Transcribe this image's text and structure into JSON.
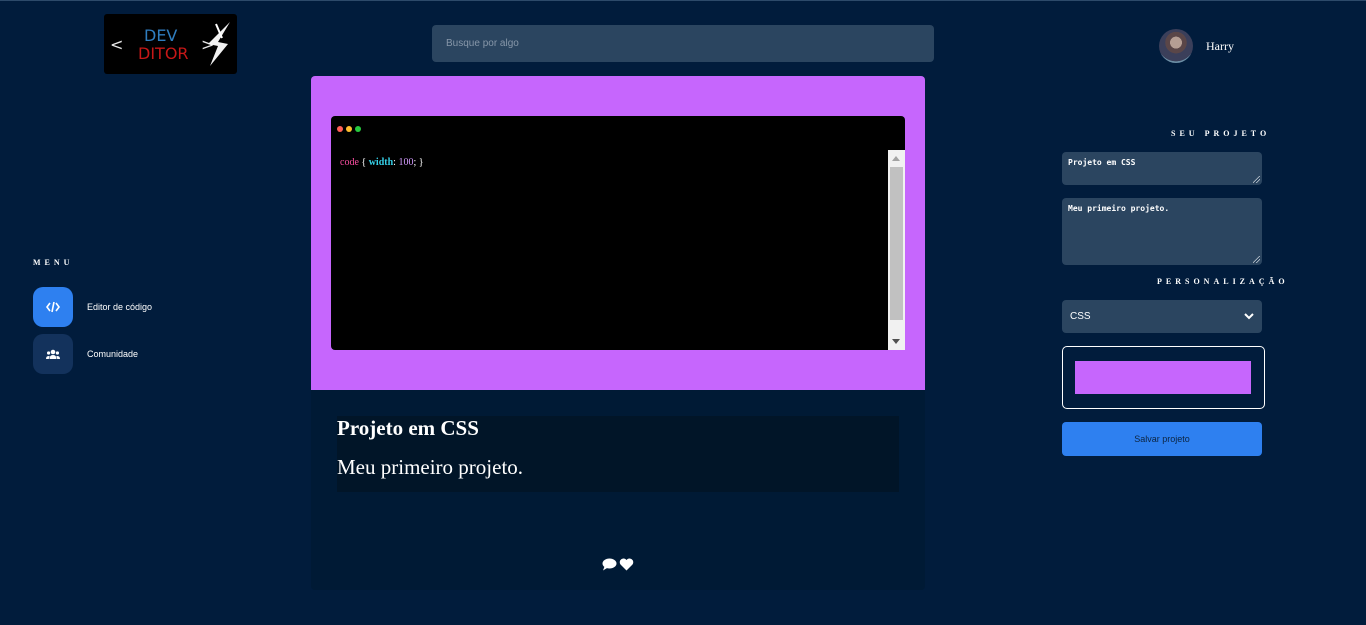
{
  "logo": {
    "left_bracket": "<",
    "line1": "DEV",
    "line2": "DITOR",
    "right_bracket": ">"
  },
  "search": {
    "placeholder": "Busque por algo",
    "value": ""
  },
  "user": {
    "name": "Harry",
    "avatar_icon": "user-avatar"
  },
  "menu": {
    "title": "MENU",
    "items": [
      {
        "label": "Editor de código",
        "icon": "code-icon",
        "active": true
      },
      {
        "label": "Comunidade",
        "icon": "users-icon",
        "active": false
      }
    ]
  },
  "editor": {
    "background_color": "#c666fd",
    "code": {
      "selector": "code",
      "open": " { ",
      "property": "width",
      "colon": ": ",
      "value": "100",
      "close": "; }"
    }
  },
  "card": {
    "title": "Projeto em CSS",
    "description": "Meu primeiro projeto.",
    "actions": [
      "comment-icon",
      "heart-icon"
    ]
  },
  "panel": {
    "project_title": "SEU PROJETO",
    "name_value": "Projeto em CSS",
    "description_value": "Meu primeiro projeto.",
    "customization_title": "PERSONALIZAÇÃO",
    "language_selected": "CSS",
    "color": "#c666fd",
    "save_label": "Salvar projeto"
  },
  "colors": {
    "background": "#011c3c",
    "accent": "#2e80f0",
    "field": "#2b4560"
  }
}
